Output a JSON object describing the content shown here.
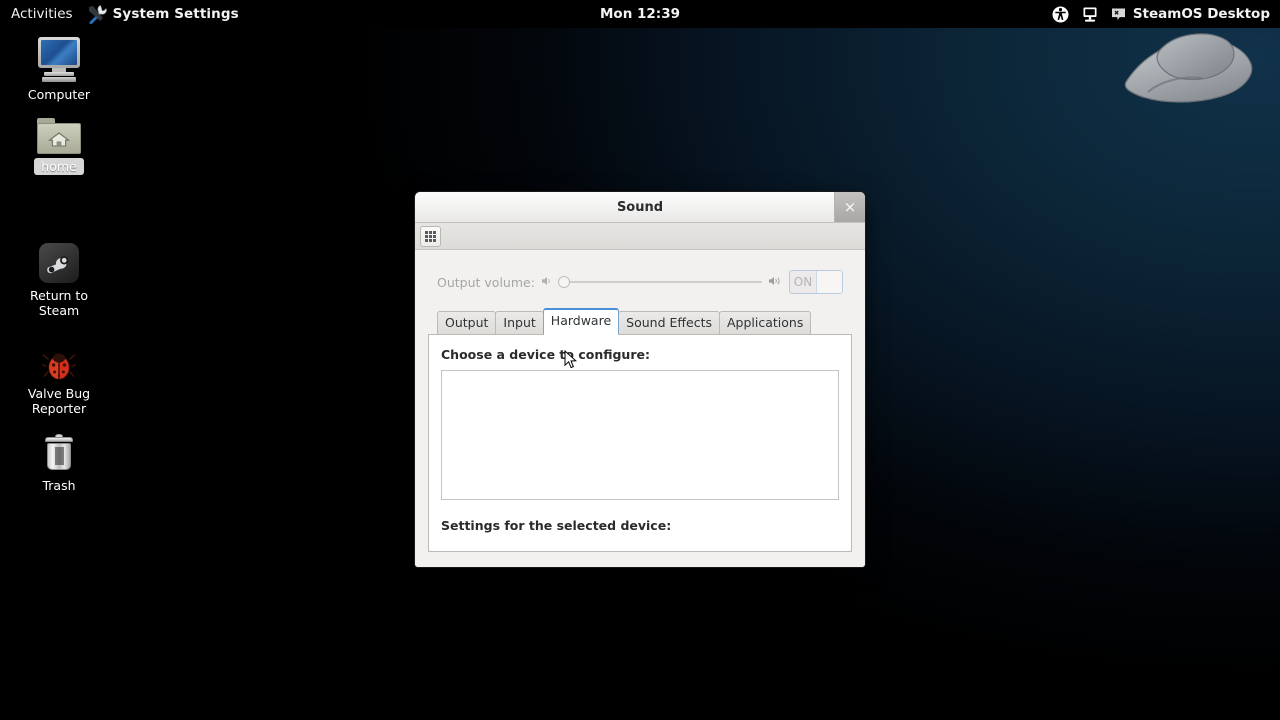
{
  "topbar": {
    "activities_label": "Activities",
    "app_name": "System Settings",
    "app_icon": "tools-icon",
    "clock": "Mon 12:39",
    "accessibility_icon": "accessibility-icon",
    "display_icon": "display-icon",
    "session_badge_icon": "session-badge-icon",
    "user_label": "SteamOS Desktop"
  },
  "desktop": {
    "icons": [
      {
        "label": "Computer",
        "icon": "computer-icon",
        "selected": false
      },
      {
        "label": "home",
        "icon": "home-folder-icon",
        "selected": true
      },
      {
        "label": "Return to Steam",
        "icon": "steam-icon",
        "selected": false
      },
      {
        "label": "Valve Bug Reporter",
        "icon": "bug-icon",
        "selected": false
      },
      {
        "label": "Trash",
        "icon": "trash-icon",
        "selected": false
      }
    ],
    "wallpaper_logo": "steamos-logo"
  },
  "sound_window": {
    "title": "Sound",
    "close_label": "×",
    "toolbar": {
      "grid_button_icon": "app-grid-icon"
    },
    "volume": {
      "label": "Output volume:",
      "min_icon": "volume-low-icon",
      "max_icon": "volume-high-icon",
      "slider_value": 0,
      "toggle_label": "ON",
      "toggle_state": "on",
      "enabled": false
    },
    "tabs": [
      {
        "label": "Output",
        "active": false
      },
      {
        "label": "Input",
        "active": false
      },
      {
        "label": "Hardware",
        "active": true
      },
      {
        "label": "Sound Effects",
        "active": false
      },
      {
        "label": "Applications",
        "active": false
      }
    ],
    "hardware_panel": {
      "choose_heading": "Choose a device to configure:",
      "device_list_items": [],
      "settings_heading": "Settings for the selected device:"
    }
  },
  "colors": {
    "accent": "#4a90d9",
    "topbar_bg": "#000000",
    "desktop_right": "#0d2a3e",
    "dialog_bg": "#f2f1f0"
  }
}
